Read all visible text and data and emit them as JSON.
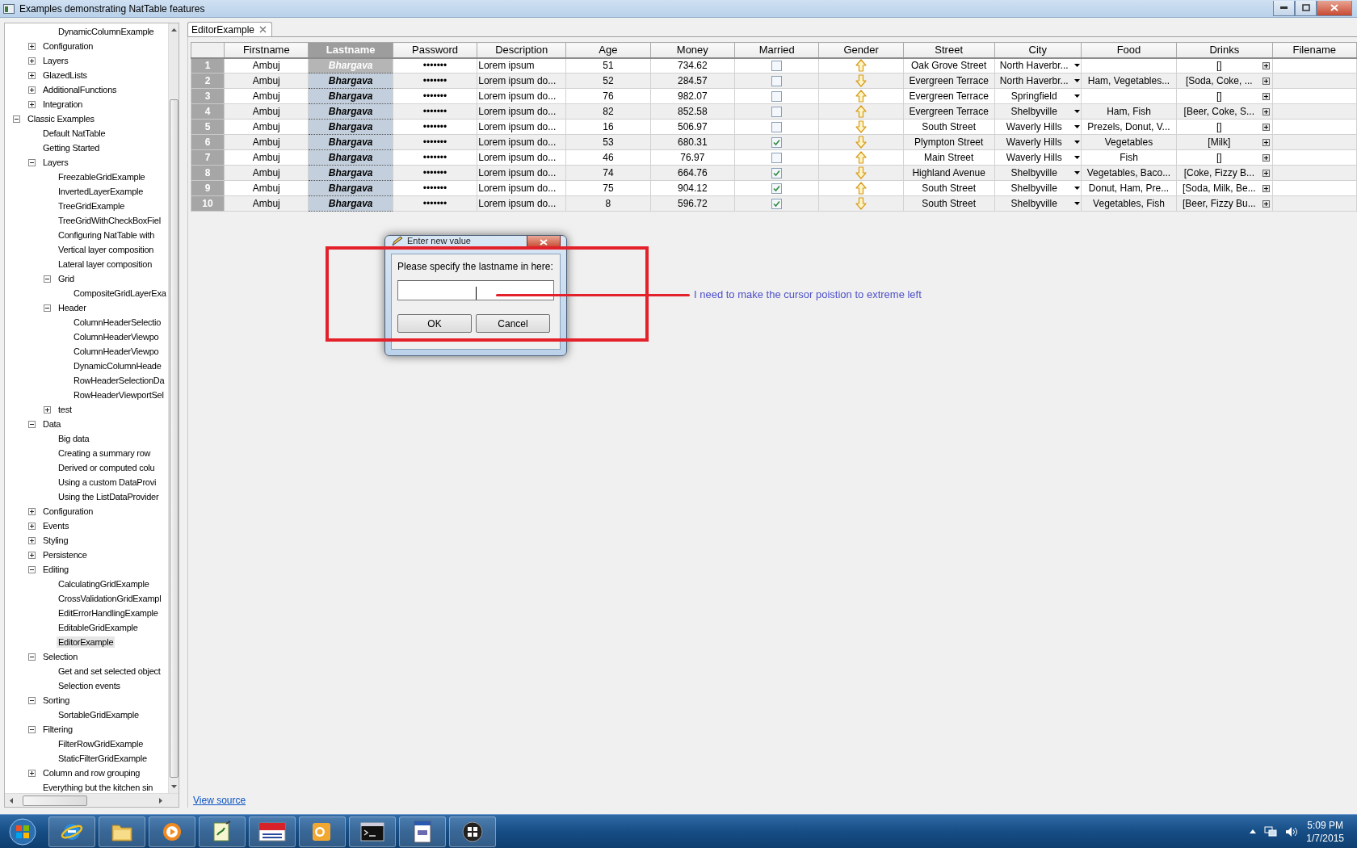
{
  "window": {
    "title": "Examples demonstrating NatTable features"
  },
  "sidebar": {
    "tree": [
      {
        "children": [
          {
            "children": [
              {
                "label": "DynamicColumnExample"
              }
            ]
          },
          {
            "label": "Configuration",
            "expanded": false
          },
          {
            "label": "Layers",
            "expanded": false
          },
          {
            "label": "GlazedLists",
            "expanded": false
          },
          {
            "label": "AdditionalFunctions",
            "expanded": false
          },
          {
            "label": "Integration",
            "expanded": false
          }
        ]
      },
      {
        "label": "Classic Examples",
        "expanded": true,
        "children": [
          {
            "label": "Default NatTable"
          },
          {
            "label": "Getting Started"
          },
          {
            "label": "Layers",
            "expanded": true,
            "children": [
              {
                "label": "FreezableGridExample"
              },
              {
                "label": "InvertedLayerExample"
              },
              {
                "label": "TreeGridExample"
              },
              {
                "label": "TreeGridWithCheckBoxFiel"
              },
              {
                "label": "Configuring NatTable with"
              },
              {
                "label": "Vertical layer composition"
              },
              {
                "label": "Lateral layer composition"
              },
              {
                "label": "Grid",
                "expanded": true,
                "children": [
                  {
                    "label": "CompositeGridLayerExa"
                  }
                ]
              },
              {
                "label": "Header",
                "expanded": true,
                "children": [
                  {
                    "label": "ColumnHeaderSelectio"
                  },
                  {
                    "label": "ColumnHeaderViewpo"
                  },
                  {
                    "label": "ColumnHeaderViewpo"
                  },
                  {
                    "label": "DynamicColumnHeade"
                  },
                  {
                    "label": "RowHeaderSelectionDa"
                  },
                  {
                    "label": "RowHeaderViewportSel"
                  }
                ]
              },
              {
                "label": "test",
                "expanded": false
              }
            ]
          },
          {
            "label": "Data",
            "expanded": true,
            "children": [
              {
                "label": "Big data"
              },
              {
                "label": "Creating a summary row"
              },
              {
                "label": "Derived or computed colu"
              },
              {
                "label": "Using a custom DataProvi"
              },
              {
                "label": "Using the ListDataProvider"
              }
            ]
          },
          {
            "label": "Configuration",
            "expanded": false
          },
          {
            "label": "Events",
            "expanded": false
          },
          {
            "label": "Styling",
            "expanded": false
          },
          {
            "label": "Persistence",
            "expanded": false
          },
          {
            "label": "Editing",
            "expanded": true,
            "children": [
              {
                "label": "CalculatingGridExample",
                "selected": false
              },
              {
                "label": "CrossValidationGridExampl",
                "selected": false
              },
              {
                "label": "EditErrorHandlingExample",
                "selected": false
              },
              {
                "label": "EditableGridExample",
                "selected": false
              },
              {
                "label": "EditorExample",
                "selected": true
              }
            ]
          },
          {
            "label": "Selection",
            "expanded": true,
            "children": [
              {
                "label": "Get and set selected object"
              },
              {
                "label": "Selection events"
              }
            ]
          },
          {
            "label": "Sorting",
            "expanded": true,
            "children": [
              {
                "label": "SortableGridExample"
              }
            ]
          },
          {
            "label": "Filtering",
            "expanded": true,
            "children": [
              {
                "label": "FilterRowGridExample"
              },
              {
                "label": "StaticFilterGridExample"
              }
            ]
          },
          {
            "label": "Column and row grouping",
            "expanded": false
          },
          {
            "label": "Everything but the kitchen sin"
          }
        ]
      }
    ]
  },
  "editor": {
    "tab": "EditorExample",
    "table": {
      "columns": [
        {
          "label": "Firstname",
          "kind": "text",
          "selected": false
        },
        {
          "label": "Lastname",
          "kind": "emphasis",
          "selected": true
        },
        {
          "label": "Password",
          "kind": "text",
          "selected": false
        },
        {
          "label": "Description",
          "kind": "note",
          "selected": false
        },
        {
          "label": "Age",
          "kind": "text",
          "selected": false
        },
        {
          "label": "Money",
          "kind": "text",
          "selected": false
        },
        {
          "label": "Married",
          "kind": "checkbox",
          "selected": false
        },
        {
          "label": "Gender",
          "kind": "arrow",
          "selected": false
        },
        {
          "label": "Street",
          "kind": "text",
          "selected": false
        },
        {
          "label": "City",
          "kind": "combo",
          "selected": false
        },
        {
          "label": "Food",
          "kind": "text",
          "selected": false
        },
        {
          "label": "Drinks",
          "kind": "list",
          "selected": false
        },
        {
          "label": "Filename",
          "kind": "text",
          "selected": false
        }
      ],
      "rows": [
        {
          "header": "1",
          "selected": true,
          "cells": [
            {
              "text": "Ambuj"
            },
            {
              "text": "Bhargava",
              "focused": true
            },
            {
              "text": "•••••••"
            },
            {
              "text": "Lorem ipsum"
            },
            {
              "text": "51"
            },
            {
              "text": "734.62"
            },
            {
              "checked": false
            },
            {
              "pointing_up": true
            },
            {
              "text": "Oak Grove Street"
            },
            {
              "text": "North Haverbr..."
            },
            {},
            {
              "text": "[]"
            }
          ]
        },
        {
          "header": "2",
          "selected": true,
          "cells": [
            {
              "text": "Ambuj"
            },
            {
              "text": "Bhargava",
              "focused": false
            },
            {
              "text": "•••••••"
            },
            {
              "text": "Lorem ipsum do..."
            },
            {
              "text": "52"
            },
            {
              "text": "284.57"
            },
            {
              "checked": false
            },
            {
              "pointing_up": false
            },
            {
              "text": "Evergreen Terrace"
            },
            {
              "text": "North Haverbr..."
            },
            {
              "text": "Ham, Vegetables..."
            },
            {
              "text": "[Soda, Coke, ..."
            }
          ]
        },
        {
          "header": "3",
          "selected": true,
          "cells": [
            {
              "text": "Ambuj"
            },
            {
              "text": "Bhargava",
              "focused": false
            },
            {
              "text": "•••••••"
            },
            {
              "text": "Lorem ipsum do..."
            },
            {
              "text": "76"
            },
            {
              "text": "982.07"
            },
            {
              "checked": false
            },
            {
              "pointing_up": true
            },
            {
              "text": "Evergreen Terrace"
            },
            {
              "text": "Springfield"
            },
            {},
            {
              "text": "[]"
            }
          ]
        },
        {
          "header": "4",
          "selected": true,
          "cells": [
            {
              "text": "Ambuj"
            },
            {
              "text": "Bhargava",
              "focused": false
            },
            {
              "text": "•••••••"
            },
            {
              "text": "Lorem ipsum do..."
            },
            {
              "text": "82"
            },
            {
              "text": "852.58"
            },
            {
              "checked": false
            },
            {
              "pointing_up": true
            },
            {
              "text": "Evergreen Terrace"
            },
            {
              "text": "Shelbyville"
            },
            {
              "text": "Ham, Fish"
            },
            {
              "text": "[Beer, Coke, S..."
            }
          ]
        },
        {
          "header": "5",
          "selected": true,
          "cells": [
            {
              "text": "Ambuj"
            },
            {
              "text": "Bhargava",
              "focused": false
            },
            {
              "text": "•••••••"
            },
            {
              "text": "Lorem ipsum do..."
            },
            {
              "text": "16"
            },
            {
              "text": "506.97"
            },
            {
              "checked": false
            },
            {
              "pointing_up": false
            },
            {
              "text": "South Street"
            },
            {
              "text": "Waverly Hills"
            },
            {
              "text": "Prezels, Donut, V..."
            },
            {
              "text": "[]"
            }
          ]
        },
        {
          "header": "6",
          "selected": true,
          "cells": [
            {
              "text": "Ambuj"
            },
            {
              "text": "Bhargava",
              "focused": false
            },
            {
              "text": "•••••••"
            },
            {
              "text": "Lorem ipsum do..."
            },
            {
              "text": "53"
            },
            {
              "text": "680.31"
            },
            {
              "checked": true
            },
            {
              "pointing_up": false
            },
            {
              "text": "Plympton Street"
            },
            {
              "text": "Waverly Hills"
            },
            {
              "text": "Vegetables"
            },
            {
              "text": "[Milk]"
            }
          ]
        },
        {
          "header": "7",
          "selected": true,
          "cells": [
            {
              "text": "Ambuj"
            },
            {
              "text": "Bhargava",
              "focused": false
            },
            {
              "text": "•••••••"
            },
            {
              "text": "Lorem ipsum do..."
            },
            {
              "text": "46"
            },
            {
              "text": "76.97"
            },
            {
              "checked": false
            },
            {
              "pointing_up": true
            },
            {
              "text": "Main Street"
            },
            {
              "text": "Waverly Hills"
            },
            {
              "text": "Fish"
            },
            {
              "text": "[]"
            }
          ]
        },
        {
          "header": "8",
          "selected": true,
          "cells": [
            {
              "text": "Ambuj"
            },
            {
              "text": "Bhargava",
              "focused": false
            },
            {
              "text": "•••••••"
            },
            {
              "text": "Lorem ipsum do..."
            },
            {
              "text": "74"
            },
            {
              "text": "664.76"
            },
            {
              "checked": true
            },
            {
              "pointing_up": false
            },
            {
              "text": "Highland Avenue"
            },
            {
              "text": "Shelbyville"
            },
            {
              "text": "Vegetables, Baco..."
            },
            {
              "text": "[Coke, Fizzy B..."
            }
          ]
        },
        {
          "header": "9",
          "selected": true,
          "cells": [
            {
              "text": "Ambuj"
            },
            {
              "text": "Bhargava",
              "focused": false
            },
            {
              "text": "•••••••"
            },
            {
              "text": "Lorem ipsum do..."
            },
            {
              "text": "75"
            },
            {
              "text": "904.12"
            },
            {
              "checked": true
            },
            {
              "pointing_up": true
            },
            {
              "text": "South Street"
            },
            {
              "text": "Shelbyville"
            },
            {
              "text": "Donut, Ham, Pre..."
            },
            {
              "text": "[Soda, Milk, Be..."
            }
          ]
        },
        {
          "header": "10",
          "selected": true,
          "cells": [
            {
              "text": "Ambuj"
            },
            {
              "text": "Bhargava",
              "focused": false
            },
            {
              "text": "•••••••"
            },
            {
              "text": "Lorem ipsum do..."
            },
            {
              "text": "8"
            },
            {
              "text": "596.72"
            },
            {
              "checked": true
            },
            {
              "pointing_up": false
            },
            {
              "text": "South Street"
            },
            {
              "text": "Shelbyville"
            },
            {
              "text": "Vegetables, Fish"
            },
            {
              "text": "[Beer, Fizzy Bu..."
            }
          ]
        }
      ]
    },
    "link": "View source"
  },
  "dialog": {
    "title": "Enter new value",
    "prompt": "Please specify the lastname in here:",
    "buttons": [
      "OK",
      "Cancel"
    ]
  },
  "annotation": {
    "text": "I need to make the cursor poistion to extreme left"
  },
  "taskbar": {
    "time": "5:09 PM",
    "date": "1/7/2015"
  }
}
